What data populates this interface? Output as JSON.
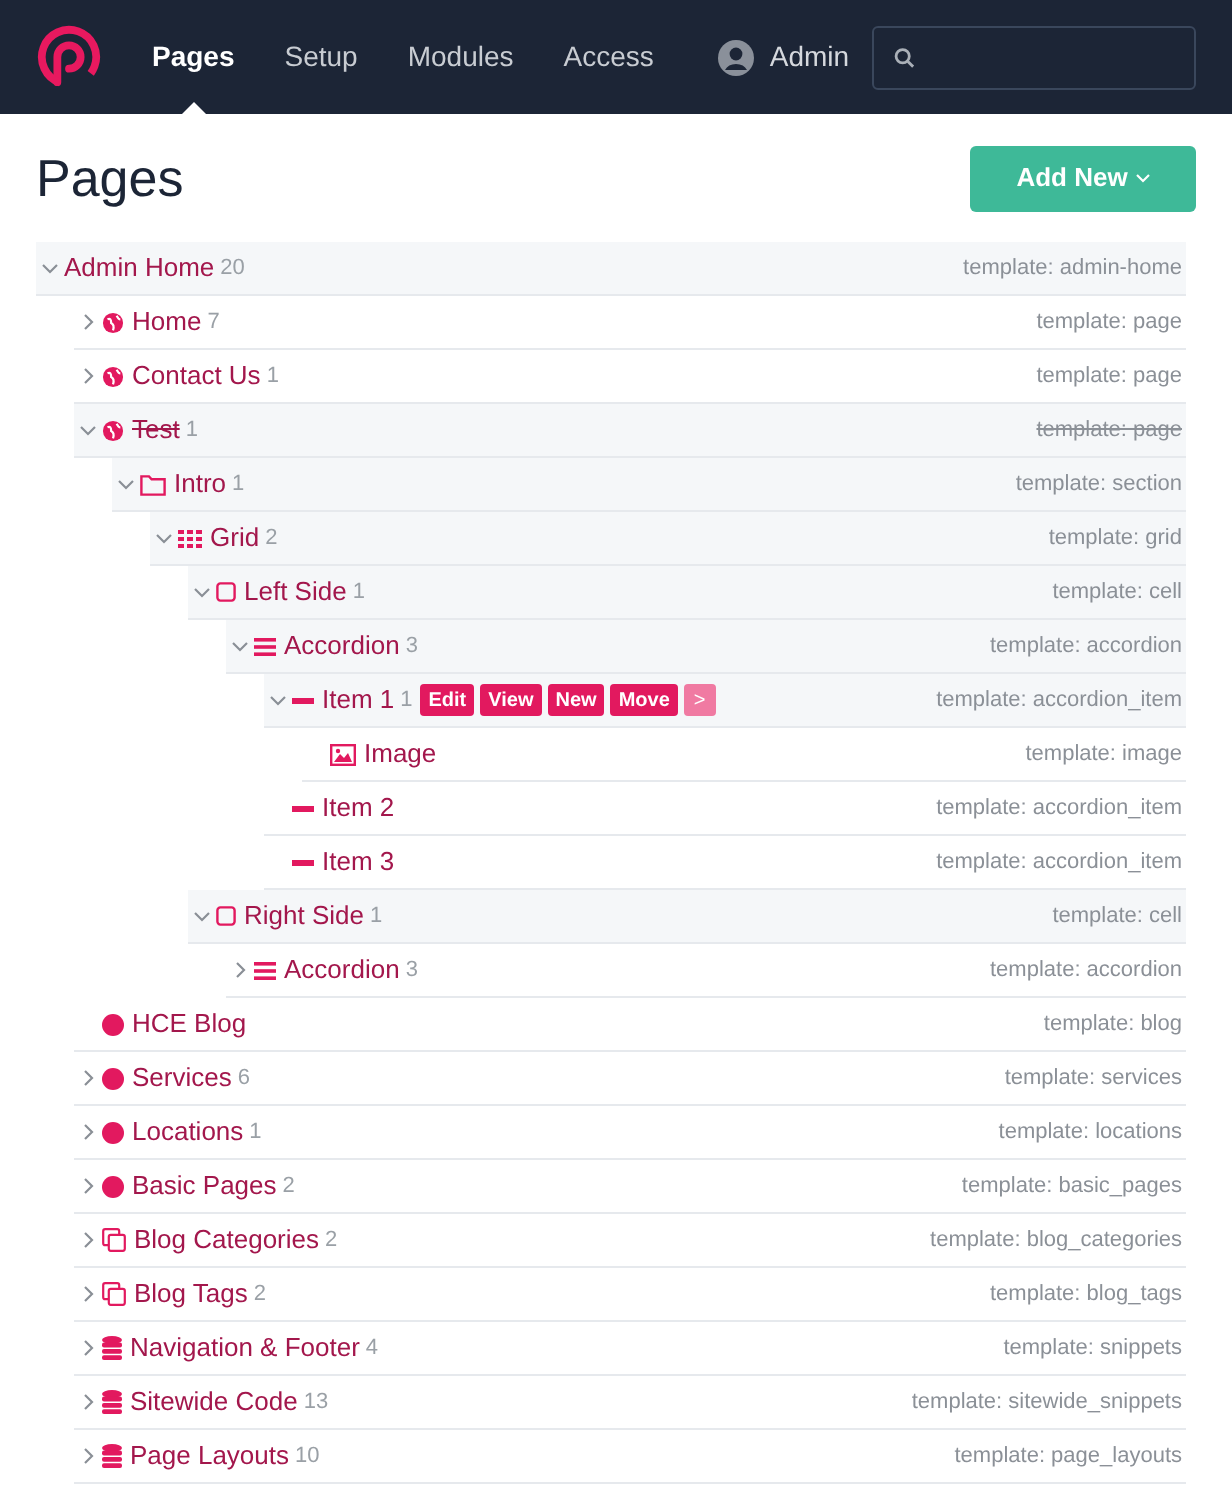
{
  "nav": {
    "items": [
      {
        "label": "Pages",
        "selected": true
      },
      {
        "label": "Setup",
        "selected": false
      },
      {
        "label": "Modules",
        "selected": false
      },
      {
        "label": "Access",
        "selected": false
      }
    ],
    "user": "Admin"
  },
  "title": "Pages",
  "add_button": {
    "label": "Add New"
  },
  "tree": [
    {
      "name": "Admin Home",
      "count": "20",
      "template": "template: admin-home",
      "has_children": true,
      "expanded": true,
      "unpublished": false,
      "children": [
        {
          "name": "Home",
          "count": "7",
          "template": "template: page",
          "kind": "globe",
          "has_children": true,
          "expanded": false,
          "unpublished": false
        },
        {
          "name": "Contact Us",
          "count": "1",
          "template": "template: page",
          "kind": "globe",
          "has_children": true,
          "expanded": false,
          "unpublished": false
        },
        {
          "name": "Test",
          "count": "1",
          "template": "template: page",
          "kind": "globe",
          "has_children": true,
          "expanded": true,
          "unpublished": true,
          "children": [
            {
              "name": "Intro",
              "count": "1",
              "template": "template: section",
              "kind": "folder",
              "has_children": true,
              "expanded": true,
              "unpublished": false,
              "children": [
                {
                  "name": "Grid",
                  "count": "2",
                  "template": "template: grid",
                  "kind": "grid",
                  "has_children": true,
                  "expanded": true,
                  "unpublished": false,
                  "children": [
                    {
                      "name": "Left Side",
                      "count": "1",
                      "template": "template: cell",
                      "kind": "square",
                      "has_children": true,
                      "expanded": true,
                      "unpublished": false,
                      "children": [
                        {
                          "name": "Accordion",
                          "count": "3",
                          "template": "template: accordion",
                          "kind": "bars",
                          "has_children": true,
                          "expanded": true,
                          "unpublished": false,
                          "children": [
                            {
                              "name": "Item 1",
                              "count": "1",
                              "template": "template: accordion_item",
                              "kind": "dash",
                              "has_children": true,
                              "expanded": true,
                              "unpublished": false,
                              "actions": [
                                {
                                  "label": "Edit",
                                  "kind": "action"
                                },
                                {
                                  "label": "View",
                                  "kind": "action"
                                },
                                {
                                  "label": "New",
                                  "kind": "action"
                                },
                                {
                                  "label": "Move",
                                  "kind": "action"
                                },
                                {
                                  "label": ">",
                                  "kind": "more"
                                }
                              ],
                              "children": [
                                {
                                  "name": "Image",
                                  "template": "template: image",
                                  "kind": "image",
                                  "has_children": false,
                                  "expanded": false,
                                  "unpublished": false
                                }
                              ]
                            },
                            {
                              "name": "Item 2",
                              "template": "template: accordion_item",
                              "kind": "dash",
                              "has_children": false,
                              "expanded": false,
                              "unpublished": false
                            },
                            {
                              "name": "Item 3",
                              "template": "template: accordion_item",
                              "kind": "dash",
                              "has_children": false,
                              "expanded": false,
                              "unpublished": false
                            }
                          ]
                        }
                      ]
                    },
                    {
                      "name": "Right Side",
                      "count": "1",
                      "template": "template: cell",
                      "kind": "square",
                      "has_children": true,
                      "expanded": true,
                      "unpublished": false,
                      "children": [
                        {
                          "name": "Accordion",
                          "count": "3",
                          "template": "template: accordion",
                          "kind": "bars",
                          "has_children": true,
                          "expanded": false,
                          "unpublished": false
                        }
                      ]
                    }
                  ]
                }
              ]
            }
          ]
        },
        {
          "name": "HCE Blog",
          "template": "template: blog",
          "kind": "dot",
          "has_children": false,
          "expanded": false,
          "unpublished": false
        },
        {
          "name": "Services",
          "count": "6",
          "template": "template: services",
          "kind": "dot",
          "has_children": true,
          "expanded": false,
          "unpublished": false
        },
        {
          "name": "Locations",
          "count": "1",
          "template": "template: locations",
          "kind": "dot",
          "has_children": true,
          "expanded": false,
          "unpublished": false
        },
        {
          "name": "Basic Pages",
          "count": "2",
          "template": "template: basic_pages",
          "kind": "dot",
          "has_children": true,
          "expanded": false,
          "unpublished": false
        },
        {
          "name": "Blog Categories",
          "count": "2",
          "template": "template: blog_categories",
          "kind": "copy",
          "has_children": true,
          "expanded": false,
          "unpublished": false
        },
        {
          "name": "Blog Tags",
          "count": "2",
          "template": "template: blog_tags",
          "kind": "copy",
          "has_children": true,
          "expanded": false,
          "unpublished": false
        },
        {
          "name": "Navigation & Footer",
          "count": "4",
          "template": "template: snippets",
          "kind": "database",
          "has_children": true,
          "expanded": false,
          "unpublished": false
        },
        {
          "name": "Sitewide Code",
          "count": "13",
          "template": "template: sitewide_snippets",
          "kind": "database",
          "has_children": true,
          "expanded": false,
          "unpublished": false
        },
        {
          "name": "Page Layouts",
          "count": "10",
          "template": "template: page_layouts",
          "kind": "database",
          "has_children": true,
          "expanded": false,
          "unpublished": false
        }
      ]
    }
  ]
}
